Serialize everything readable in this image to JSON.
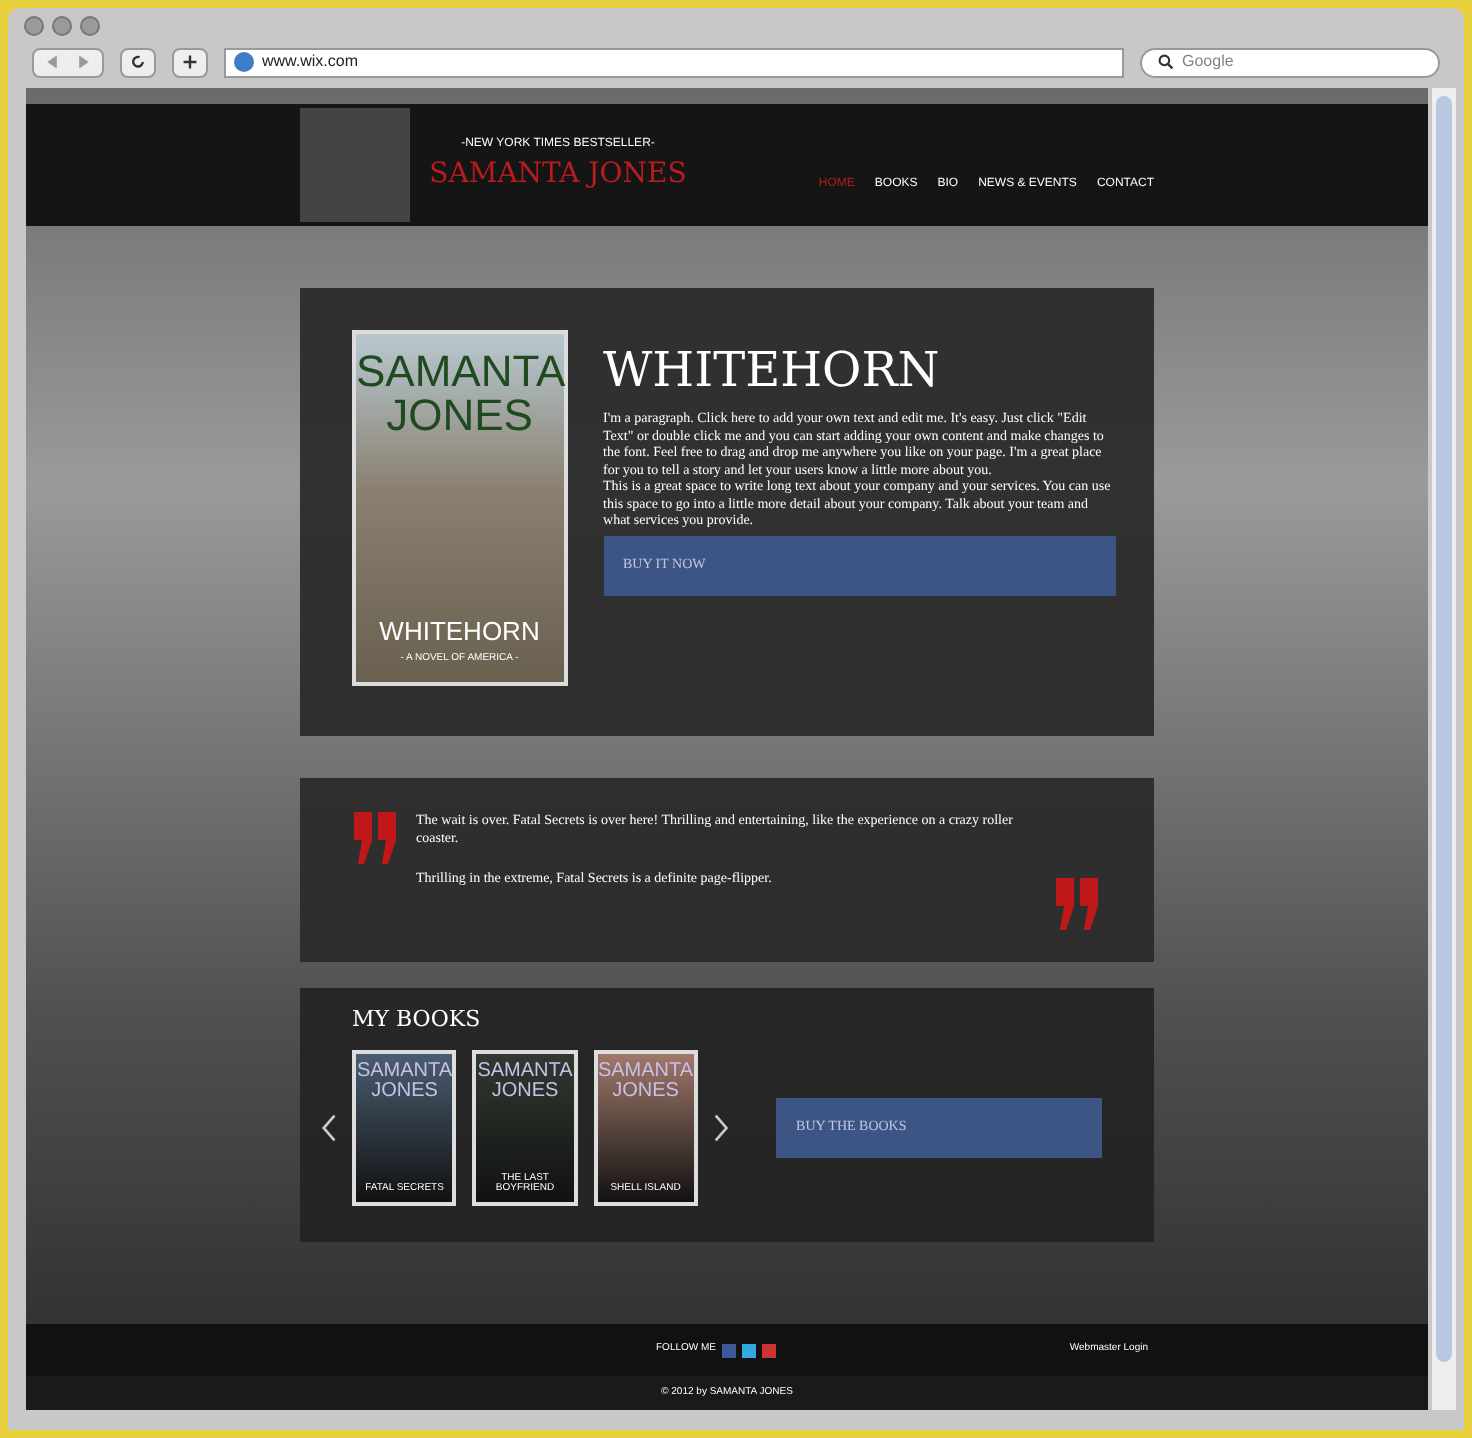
{
  "browser": {
    "url": "www.wix.com",
    "search_placeholder": "Google"
  },
  "header": {
    "tagline": "-NEW YORK TIMES BESTSELLER-",
    "author": "SAMANTA JONES",
    "nav": [
      {
        "label": "HOME",
        "selected": true
      },
      {
        "label": "BOOKS",
        "selected": false
      },
      {
        "label": "BIO",
        "selected": false
      },
      {
        "label": "NEWS & EVENTS",
        "selected": false
      },
      {
        "label": "CONTACT",
        "selected": false
      }
    ]
  },
  "feature": {
    "cover": {
      "author": "SAMANTA JONES",
      "title": "WHITEHORN",
      "subtitle": "- A NOVEL OF AMERICA -"
    },
    "title": "WHITEHORN",
    "paragraphs": [
      "I'm a paragraph. Click here to add your own text and edit me. It's easy. Just click \"Edit Text\" or double click me and you can start adding your own content and make changes to the font. Feel free to drag and drop me anywhere you like on your page. I'm a great place for you to tell a story and let your users know a little more about you.",
      "This is a great space to write long text about your company and your services. You can use this space to go into a little more detail about your company. Talk about your team and what services you provide."
    ],
    "button": "BUY IT NOW"
  },
  "quotes": [
    "The wait is over. Fatal Secrets is over here! Thrilling and entertaining, like the experience on a crazy roller coaster.",
    "Thrilling in the extreme, Fatal Secrets is a definite page-flipper."
  ],
  "books": {
    "title": "MY BOOKS",
    "items": [
      {
        "author": "SAMANTA JONES",
        "title": "FATAL SECRETS",
        "color": "#4a5d70"
      },
      {
        "author": "SAMANTA JONES",
        "title": "THE LAST BOYFRIEND",
        "color": "#2f3a30"
      },
      {
        "author": "SAMANTA JONES",
        "title": "SHELL ISLAND",
        "color": "#a0786a"
      }
    ],
    "button": "BUY THE BOOKS"
  },
  "footer": {
    "follow": "FOLLOW ME",
    "login": "Webmaster Login",
    "copyright": "© 2012 by SAMANTA JONES"
  }
}
